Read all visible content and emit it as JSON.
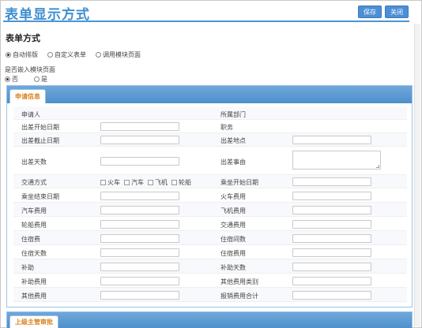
{
  "header": {
    "title": "表单显示方式",
    "save_label": "保存",
    "close_label": "关闭"
  },
  "form_mode": {
    "title": "表单方式",
    "options": [
      {
        "label": "自动排版",
        "checked": true
      },
      {
        "label": "自定义表单",
        "checked": false
      },
      {
        "label": "调用模块页面",
        "checked": false
      }
    ]
  },
  "embed": {
    "label": "是否嵌入模块页面",
    "options": [
      {
        "label": "否",
        "checked": true
      },
      {
        "label": "是",
        "checked": false
      }
    ]
  },
  "panel1": {
    "tab": "申请信息",
    "rows": [
      {
        "left": "申请人",
        "right": "所属部门"
      },
      {
        "left": "出差开始日期",
        "right": "职务"
      },
      {
        "left": "出差截止日期",
        "right": "出差地点"
      },
      {
        "left": "出差天数",
        "right": "出差事由"
      },
      {
        "left": "交通方式",
        "right": "乘坐开始日期"
      },
      {
        "left": "乘坐结束日期",
        "right": "火车费用"
      },
      {
        "left": "汽车费用",
        "right": "飞机费用"
      },
      {
        "left": "轮船费用",
        "right": "交通费用"
      },
      {
        "left": "住宿费",
        "right": "住宿间数"
      },
      {
        "left": "住宿天数",
        "right": "住宿费用"
      },
      {
        "left": "补助",
        "right": "补助天数"
      },
      {
        "left": "补助费用",
        "right": "其他费用类别"
      },
      {
        "left": "其他费用",
        "right": "报销费用合计"
      }
    ],
    "transport_options": [
      "火车",
      "汽车",
      "飞机",
      "轮船"
    ]
  },
  "panel2": {
    "tab": "上级主管审批"
  }
}
